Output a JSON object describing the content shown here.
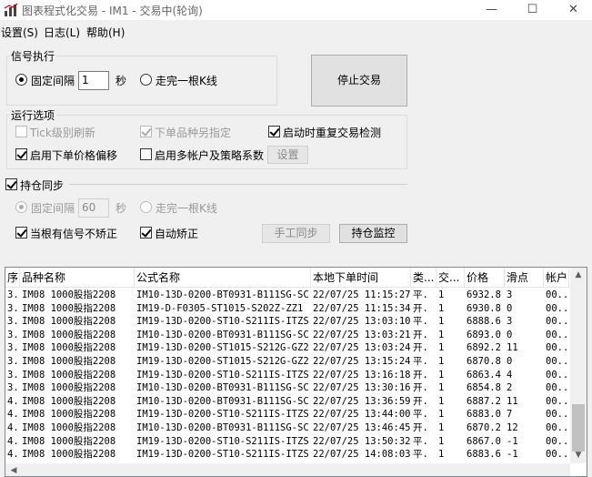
{
  "window": {
    "title": "图表程式化交易 - IM1 - 交易中(轮询)",
    "minimize": "—",
    "maximize": "☐",
    "close": "✕"
  },
  "menu": [
    "设置(S)",
    "日志(L)",
    "帮助(H)"
  ],
  "signal": {
    "group_title": "信号执行",
    "fixed_interval_label": "固定间隔",
    "interval_value": "1",
    "seconds_label": "秒",
    "kline_label": "走完一根K线",
    "stop_button": "停止交易"
  },
  "options": {
    "group_title": "运行选项",
    "tick_refresh": "Tick级别刷新",
    "different_symbol": "下单品种另指定",
    "restart_check": "启动时重复交易检测",
    "price_offset": "启用下单价格偏移",
    "multi_account": "启用多帐户及策略系数",
    "settings_button": "设置"
  },
  "position_sync": {
    "label": "持仓同步",
    "fixed_interval_label": "固定间隔",
    "interval_value": "60",
    "seconds_label": "秒",
    "kline_label": "走完一根K线",
    "no_correct_label": "当根有信号不矫正",
    "auto_correct_label": "自动矫正",
    "manual_sync_button": "手工同步",
    "monitor_button": "持仓监控"
  },
  "table": {
    "headers": [
      "序",
      "品种名称",
      "公式名称",
      "本地下单时间",
      "类...",
      "交...",
      "价格",
      "滑点",
      "帐户"
    ],
    "rows": [
      [
        "3.",
        "IM08 1000股指2208",
        "IM10-13D-0200-BT0931-B111SG-SC",
        "22/07/25 11:15:27",
        "平.",
        "1",
        "6932.8",
        "3",
        "00.."
      ],
      [
        "3.",
        "IM08 1000股指2208",
        "IM19-D-F0305-ST1015-S202Z-ZZ1",
        "22/07/25 11:15:34",
        "开.",
        "1",
        "6930.8",
        "0",
        "00.."
      ],
      [
        "3.",
        "IM08 1000股指2208",
        "IM19-13D-0200-ST10-S211IS-ITZS",
        "22/07/25 13:03:10",
        "平.",
        "1",
        "6888.6",
        "3",
        "00.."
      ],
      [
        "3.",
        "IM08 1000股指2208",
        "IM10-13D-0200-BT0931-B111SG-SC",
        "22/07/25 13:03:21",
        "开.",
        "1",
        "6893.0",
        "0",
        "00.."
      ],
      [
        "3.",
        "IM08 1000股指2208",
        "IM19-13D-0200-ST1015-S212G-GZ2",
        "22/07/25 13:03:24",
        "开.",
        "1",
        "6892.2",
        "11",
        "00.."
      ],
      [
        "3.",
        "IM08 1000股指2208",
        "IM19-13D-0200-ST1015-S212G-GZ2",
        "22/07/25 13:15:24",
        "平.",
        "1",
        "6870.8",
        "0",
        "00.."
      ],
      [
        "3.",
        "IM08 1000股指2208",
        "IM19-13D-0200-ST10-S211IS-ITZS",
        "22/07/25 13:16:18",
        "开.",
        "1",
        "6863.4",
        "4",
        "00.."
      ],
      [
        "3.",
        "IM08 1000股指2208",
        "IM10-13D-0200-BT0931-B111SG-SC",
        "22/07/25 13:30:16",
        "开.",
        "1",
        "6854.8",
        "2",
        "00.."
      ],
      [
        "4.",
        "IM08 1000股指2208",
        "IM10-13D-0200-BT0931-B111SG-SC",
        "22/07/25 13:36:59",
        "开.",
        "1",
        "6887.2",
        "11",
        "00.."
      ],
      [
        "4.",
        "IM08 1000股指2208",
        "IM19-13D-0200-ST10-S211IS-ITZS",
        "22/07/25 13:44:00",
        "平.",
        "1",
        "6883.0",
        "7",
        "00.."
      ],
      [
        "4.",
        "IM08 1000股指2208",
        "IM10-13D-0200-BT0931-B111SG-SC",
        "22/07/25 13:46:45",
        "开.",
        "1",
        "6870.2",
        "12",
        "00.."
      ],
      [
        "4.",
        "IM08 1000股指2208",
        "IM19-13D-0200-ST10-S211IS-ITZS",
        "22/07/25 13:50:32",
        "平.",
        "1",
        "6867.0",
        "-1",
        "00.."
      ],
      [
        "4.",
        "IM08 1000股指2208",
        "IM19-13D-0200-ST10-S211IS-ITZS",
        "22/07/25 14:08:03",
        "平.",
        "1",
        "6883.6",
        "-1",
        "00.."
      ]
    ]
  }
}
